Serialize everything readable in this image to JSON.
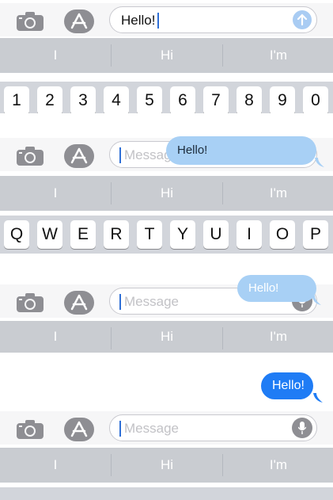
{
  "frames": [
    {
      "field_text": "Hello!",
      "suggestions": [
        "I",
        "Hi",
        "I'm"
      ],
      "keys": [
        "1",
        "2",
        "3",
        "4",
        "5",
        "6",
        "7",
        "8",
        "9",
        "0"
      ]
    },
    {
      "field_placeholder": "Message",
      "bubble": "Hello!",
      "suggestions": [
        "I",
        "Hi",
        "I'm"
      ],
      "keys": [
        "Q",
        "W",
        "E",
        "R",
        "T",
        "Y",
        "U",
        "I",
        "O",
        "P"
      ]
    },
    {
      "field_placeholder": "Message",
      "bubble": "Hello!",
      "suggestions": [
        "I",
        "Hi",
        "I'm"
      ]
    },
    {
      "bubble": "Hello!"
    },
    {
      "field_placeholder": "Message",
      "suggestions": [
        "I",
        "Hi",
        "I'm"
      ]
    }
  ],
  "colors": {
    "accent_blue": "#1f7cf5",
    "bubble_light": "#a8d0f5",
    "suggestion_bar": "#c9ccd1",
    "keyboard_bg": "#d2d5db"
  },
  "icons": [
    "camera-icon",
    "app-store-icon",
    "send-arrow-icon",
    "microphone-icon"
  ]
}
